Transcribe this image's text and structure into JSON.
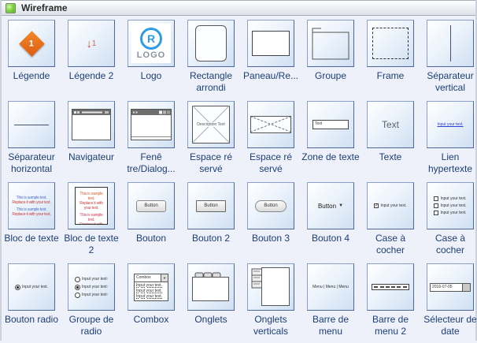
{
  "header": {
    "title": "Wireframe"
  },
  "glyphs": {
    "one": "1",
    "down_arrow": "↓",
    "logo_r": "R",
    "logo_word": "LOGO",
    "placeholder": "Description Text",
    "text_label": "Text",
    "input_text": "Input your text.",
    "input_text_colon": "Input your text:",
    "sample_line1": "This is sample text.",
    "sample_line2": "Replace it with your text.",
    "button": "Button",
    "dropdown_arrow": "▼",
    "check": "✓",
    "combox": "Combox",
    "menu_bar": "Menu | Menu | Menu",
    "date": "2016-07-05"
  },
  "colors": {
    "tile_border": "#4f6699",
    "label_text": "#1c3e74",
    "diamond_orange": "#dd5a12",
    "logo_blue": "#2e9be6",
    "link_blue": "#2b3fd4",
    "header_icon_green": "#46a718"
  },
  "palette": {
    "items": [
      {
        "label": "Légende"
      },
      {
        "label": "Légende 2"
      },
      {
        "label": "Logo"
      },
      {
        "label": "Rectangle arrondi"
      },
      {
        "label": "Paneau/Re..."
      },
      {
        "label": "Groupe"
      },
      {
        "label": "Frame"
      },
      {
        "label": "Séparateur vertical"
      },
      {
        "label": "Séparateur horizontal"
      },
      {
        "label": "Navigateur"
      },
      {
        "label": "Fenê tre/Dialog..."
      },
      {
        "label": "Espace ré servé"
      },
      {
        "label": "Espace ré servé"
      },
      {
        "label": "Zone de texte"
      },
      {
        "label": "Texte"
      },
      {
        "label": "Lien hypertexte"
      },
      {
        "label": "Bloc de texte"
      },
      {
        "label": "Bloc de texte 2"
      },
      {
        "label": "Bouton"
      },
      {
        "label": "Bouton 2"
      },
      {
        "label": "Bouton 3"
      },
      {
        "label": "Bouton 4"
      },
      {
        "label": "Case à cocher"
      },
      {
        "label": "Case à cocher"
      },
      {
        "label": "Bouton radio"
      },
      {
        "label": "Groupe de radio"
      },
      {
        "label": "Combox"
      },
      {
        "label": "Onglets"
      },
      {
        "label": "Onglets verticals"
      },
      {
        "label": "Barre de menu"
      },
      {
        "label": "Barre de menu 2"
      },
      {
        "label": "Sélecteur de date"
      }
    ]
  }
}
